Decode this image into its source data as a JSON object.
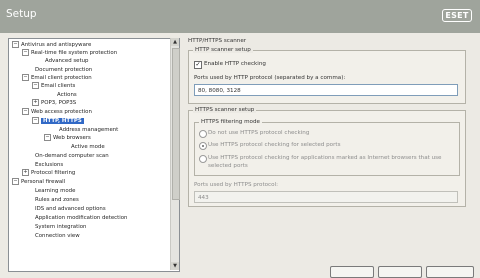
{
  "window": {
    "title": "Setup",
    "logo_text": "eset"
  },
  "tree": {
    "items": [
      {
        "label": "Antivirus and antispyware",
        "expander": "−"
      },
      {
        "label": "Real-time file system protection",
        "expander": "−"
      },
      {
        "label": "Advanced setup",
        "expander": ""
      },
      {
        "label": "Document protection",
        "expander": ""
      },
      {
        "label": "Email client protection",
        "expander": "−"
      },
      {
        "label": "Email clients",
        "expander": "−"
      },
      {
        "label": "Actions",
        "expander": ""
      },
      {
        "label": "POP3, POP3S",
        "expander": "+"
      },
      {
        "label": "Web access protection",
        "expander": "−"
      },
      {
        "label": "HTTP, HTTPS",
        "expander": "−"
      },
      {
        "label": "Address management",
        "expander": ""
      },
      {
        "label": "Web browsers",
        "expander": "−"
      },
      {
        "label": "Active mode",
        "expander": ""
      },
      {
        "label": "On-demand computer scan",
        "expander": ""
      },
      {
        "label": "Exclusions",
        "expander": ""
      },
      {
        "label": "Protocol filtering",
        "expander": "+"
      },
      {
        "label": "Personal firewall",
        "expander": "−"
      },
      {
        "label": "Learning mode",
        "expander": ""
      },
      {
        "label": "Rules and zones",
        "expander": ""
      },
      {
        "label": "IDS and advanced options",
        "expander": ""
      },
      {
        "label": "Application modification detection",
        "expander": ""
      },
      {
        "label": "System integration",
        "expander": ""
      },
      {
        "label": "Connection view",
        "expander": ""
      }
    ]
  },
  "main": {
    "header": "HTTP/HTTPS scanner",
    "http_setup": {
      "legend": "HTTP scanner setup",
      "enable_label": "Enable HTTP checking",
      "enable_checked": true,
      "ports_label": "Ports used by HTTP protocol (separated by a comma):",
      "ports_value": "80, 8080, 3128"
    },
    "https_setup": {
      "legend": "HTTPS scanner setup",
      "mode_legend": "HTTPS filtering mode",
      "options": [
        {
          "label": "Do not use HTTPS protocol checking",
          "selected": false
        },
        {
          "label": "Use HTTPS protocol checking for selected ports",
          "selected": true
        },
        {
          "label": "Use HTTPS protocol checking for applications marked as Internet browsers that use",
          "selected": false
        }
      ],
      "option3_line2": "selected ports",
      "ports_label": "Ports used by HTTPS protocol:",
      "ports_value": "443"
    }
  }
}
